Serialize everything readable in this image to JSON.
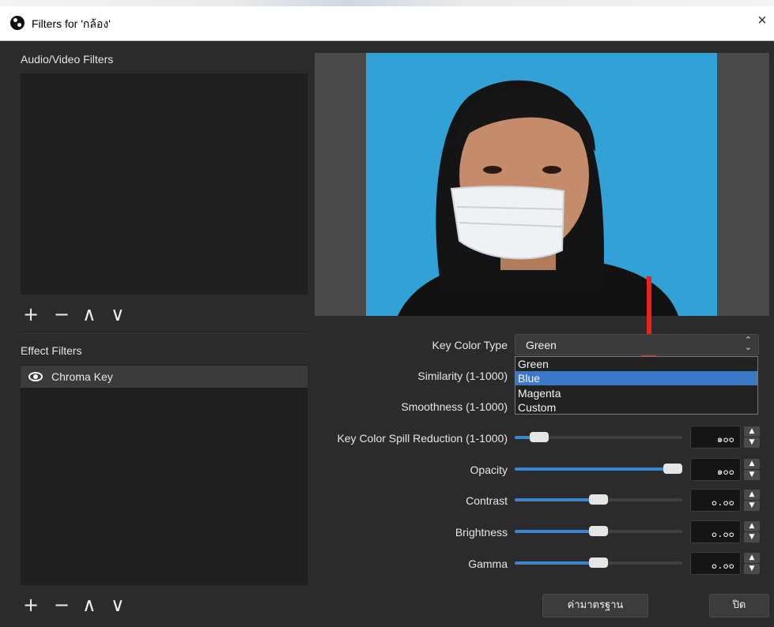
{
  "window": {
    "title": "Filters for 'กล้อง'",
    "close_label": "×"
  },
  "audio_video": {
    "header": "Audio/Video Filters"
  },
  "effect": {
    "header": "Effect Filters",
    "items": [
      {
        "label": "Chroma Key",
        "visible": true
      }
    ]
  },
  "toolbar": {
    "add": "+",
    "remove": "−",
    "up": "∧",
    "down": "∨"
  },
  "properties": {
    "key_color_type": {
      "label": "Key Color Type",
      "value": "Green",
      "options": [
        "Green",
        "Blue",
        "Magenta",
        "Custom"
      ],
      "highlighted": "Blue"
    },
    "similarity": {
      "label": "Similarity (1-1000)"
    },
    "smoothness": {
      "label": "Smoothness (1-1000)"
    },
    "spill": {
      "label": "Key Color Spill Reduction (1-1000)",
      "value": "๑๐๐",
      "level": 0.1
    },
    "opacity": {
      "label": "Opacity",
      "value": "๑๐๐",
      "level": 1.0
    },
    "contrast": {
      "label": "Contrast",
      "value": "๐.๐๐",
      "level": 0.5
    },
    "brightness": {
      "label": "Brightness",
      "value": "๐.๐๐",
      "level": 0.5
    },
    "gamma": {
      "label": "Gamma",
      "value": "๐.๐๐",
      "level": 0.5
    }
  },
  "buttons": {
    "defaults": "ค่ามาตรฐาน",
    "close": "ปิด"
  },
  "colors": {
    "background": "#2b2b2b",
    "panel": "#1f1f1f",
    "accent": "#3a86d0",
    "selection": "#3d78c7",
    "annotation_arrow": "#e8231a",
    "chroma_backdrop": "#2f9fd4"
  },
  "icons": {
    "app": "obs-logo-icon",
    "eye": "eye-icon",
    "arrow": "red-down-arrow"
  }
}
